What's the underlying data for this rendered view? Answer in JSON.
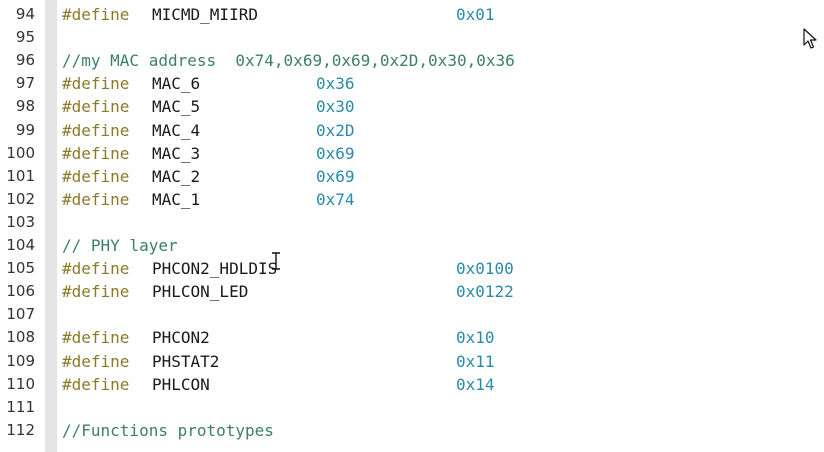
{
  "lines": [
    {
      "num": "94",
      "kind": "define",
      "keyword": "#define",
      "name": "MICMD_MIIRD",
      "value": "0x01",
      "col": 2
    },
    {
      "num": "95",
      "kind": "blank"
    },
    {
      "num": "96",
      "kind": "comment",
      "text": "//my MAC address  0x74,0x69,0x69,0x2D,0x30,0x36"
    },
    {
      "num": "97",
      "kind": "define",
      "keyword": "#define",
      "name": "MAC_6",
      "value": "0x36",
      "col": 1
    },
    {
      "num": "98",
      "kind": "define",
      "keyword": "#define",
      "name": "MAC_5",
      "value": "0x30",
      "col": 1
    },
    {
      "num": "99",
      "kind": "define",
      "keyword": "#define",
      "name": "MAC_4",
      "value": "0x2D",
      "col": 1
    },
    {
      "num": "100",
      "kind": "define",
      "keyword": "#define",
      "name": "MAC_3",
      "value": "0x69",
      "col": 1
    },
    {
      "num": "101",
      "kind": "define",
      "keyword": "#define",
      "name": "MAC_2",
      "value": "0x69",
      "col": 1
    },
    {
      "num": "102",
      "kind": "define",
      "keyword": "#define",
      "name": "MAC_1",
      "value": "0x74",
      "col": 1
    },
    {
      "num": "103",
      "kind": "blank"
    },
    {
      "num": "104",
      "kind": "comment",
      "text": "// PHY layer"
    },
    {
      "num": "105",
      "kind": "define",
      "keyword": "#define",
      "name": "PHCON2_HDLDIS",
      "value": "0x0100",
      "col": 2
    },
    {
      "num": "106",
      "kind": "define",
      "keyword": "#define",
      "name": "PHLCON_LED",
      "value": "0x0122",
      "col": 2
    },
    {
      "num": "107",
      "kind": "blank"
    },
    {
      "num": "108",
      "kind": "define",
      "keyword": "#define",
      "name": "PHCON2",
      "value": "0x10",
      "col": 2
    },
    {
      "num": "109",
      "kind": "define",
      "keyword": "#define",
      "name": "PHSTAT2",
      "value": "0x11",
      "col": 2
    },
    {
      "num": "110",
      "kind": "define",
      "keyword": "#define",
      "name": "PHLCON",
      "value": "0x14",
      "col": 2
    },
    {
      "num": "111",
      "kind": "blank"
    },
    {
      "num": "112",
      "kind": "comment",
      "text": "//Functions prototypes"
    }
  ],
  "colors": {
    "keyword": "#8a7a2a",
    "hex": "#2a8aa8",
    "comment": "#3d7f6a",
    "identifier": "#1a1a1a"
  },
  "icons": {
    "text_cursor": "i-beam-cursor-icon",
    "pointer": "arrow-pointer-icon"
  }
}
